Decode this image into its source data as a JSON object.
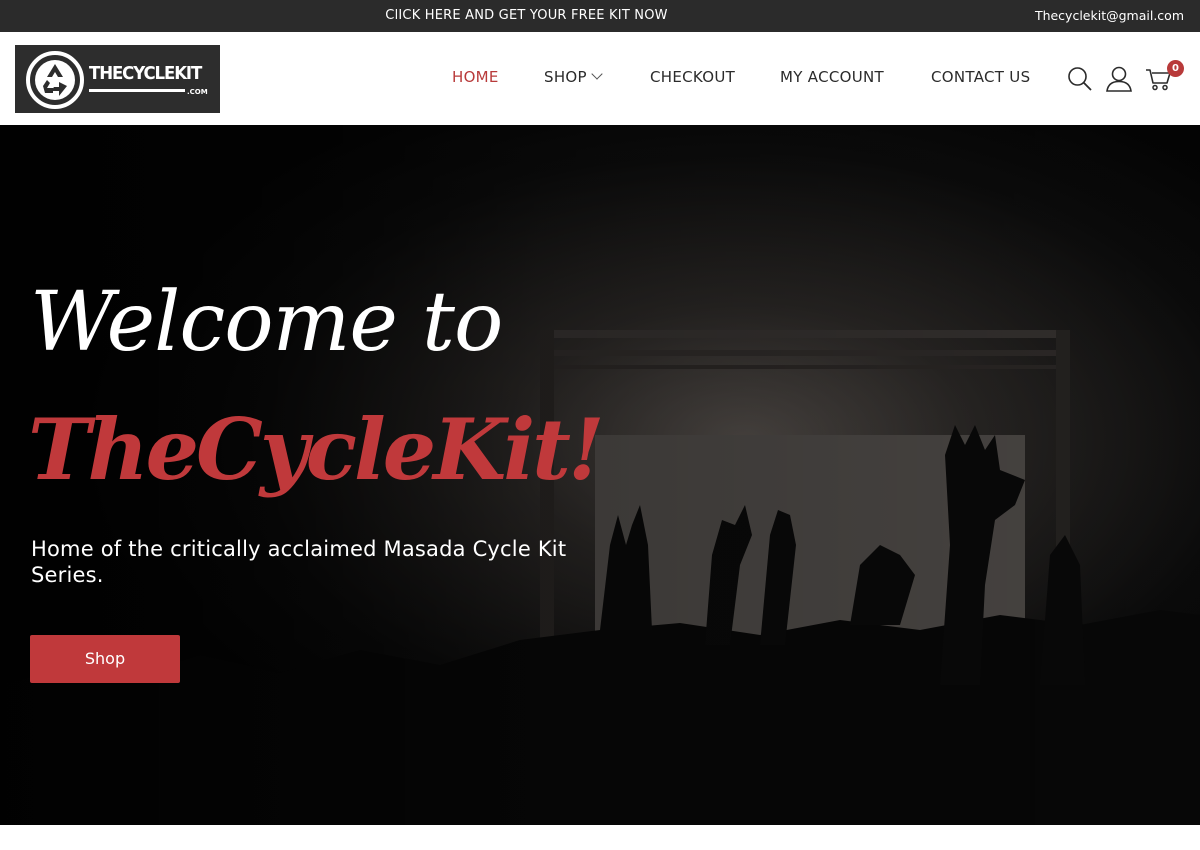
{
  "topbar": {
    "promo_text": "ClICK HERE AND GET YOUR FREE KIT NOW",
    "email": "Thecyclekit@gmail.com"
  },
  "logo": {
    "wordmark": "THECYCLEKIT",
    "suffix": ".COM"
  },
  "nav": {
    "items": [
      {
        "label": "HOME",
        "active": true
      },
      {
        "label": "SHOP",
        "has_dropdown": true
      },
      {
        "label": "CHECKOUT"
      },
      {
        "label": "MY ACCOUNT"
      },
      {
        "label": "CONTACT US"
      }
    ],
    "icons": [
      "search-icon",
      "user-icon",
      "cart-icon"
    ],
    "cart_count": "0"
  },
  "hero": {
    "line1": "Welcome to",
    "line2": "TheCycleKit!",
    "subtitle": "Home of the critically acclaimed Masada Cycle Kit Series.",
    "button_label": "Shop"
  },
  "colors": {
    "accent": "#c0393b",
    "topbar_bg": "#2b2b2b",
    "hero_bg": "#050505"
  }
}
